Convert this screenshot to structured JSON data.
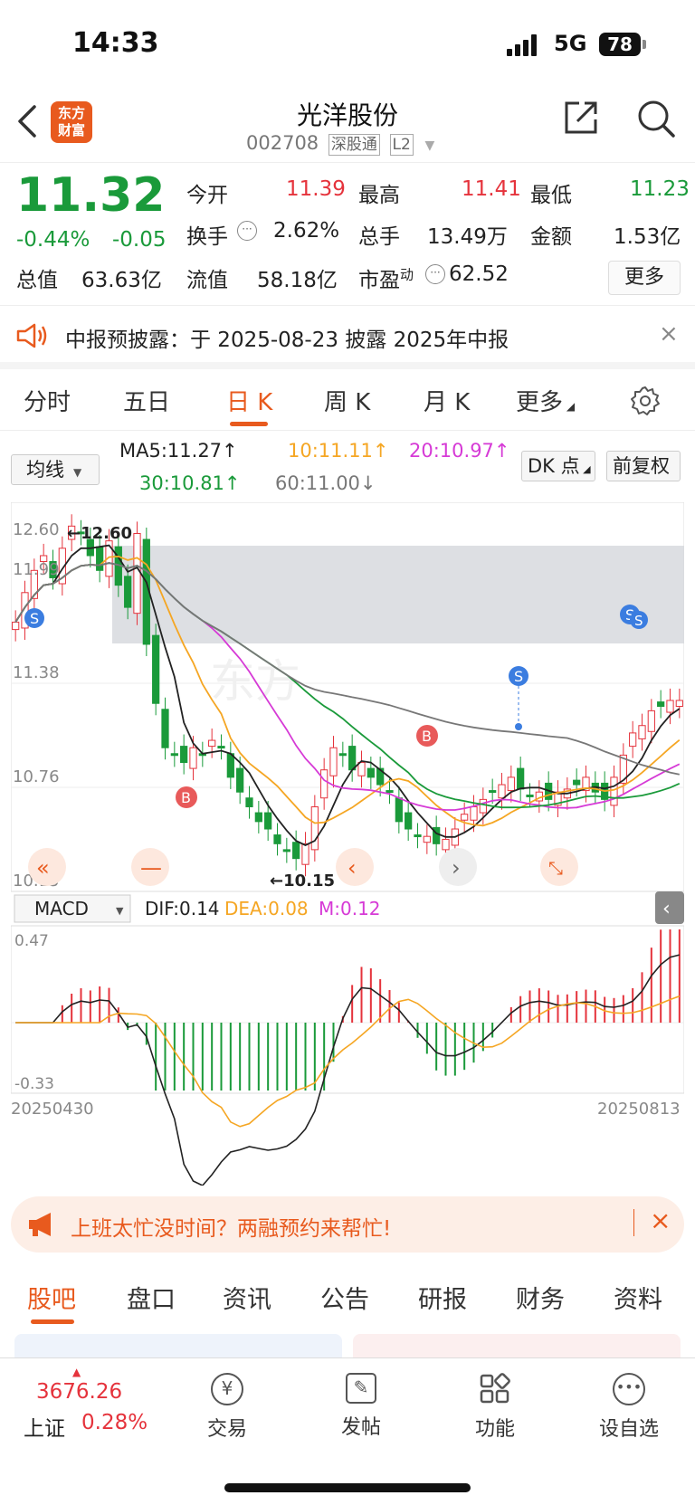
{
  "status": {
    "time": "14:33",
    "network": "5G",
    "battery": "78"
  },
  "nav": {
    "logo_top": "东方",
    "logo_bottom": "财富",
    "title": "光洋股份",
    "code": "002708",
    "tag1": "深股通",
    "tag2": "L2"
  },
  "quote": {
    "price": "11.32",
    "change_pct": "-0.44%",
    "change": "-0.05",
    "open_label": "今开",
    "open": "11.39",
    "high_label": "最高",
    "high": "11.41",
    "low_label": "最低",
    "low": "11.23",
    "turnover_label": "换手",
    "turnover": "2.62%",
    "volume_label": "总手",
    "volume": "13.49万",
    "amount_label": "金额",
    "amount": "1.53亿",
    "mktcap_label": "总值",
    "mktcap": "63.63亿",
    "float_label": "流值",
    "float": "58.18亿",
    "pe_label": "市盈",
    "pe_sup": "动",
    "pe": "62.52",
    "more": "更多"
  },
  "notice": {
    "text": "中报预披露：于 2025-08-23 披露 2025年中报"
  },
  "tabs": [
    "分时",
    "五日",
    "日 K",
    "周 K",
    "月 K",
    "更多"
  ],
  "ma": {
    "select": "均线",
    "ma5": "MA5:11.27↑",
    "ma10": "10:11.11↑",
    "ma20": "20:10.97↑",
    "ma30": "30:10.81↑",
    "ma60": "60:11.00↓",
    "dk": "DK 点",
    "adjust": "前复权"
  },
  "chart_data": [
    {
      "type": "candlestick",
      "y_ticks": [
        "12.60",
        "11.99",
        "11.38",
        "10.76",
        "10.15"
      ],
      "ylim": [
        10.15,
        12.6
      ],
      "annotations": {
        "high": "←12.60",
        "low": "←10.15"
      },
      "colors": {
        "up": "#e5333c",
        "down": "#1a9a3a",
        "ma5": "#222222",
        "ma10": "#f5a623",
        "ma20": "#d63ad6",
        "ma30": "#1a9a3a",
        "ma60": "#777777"
      }
    },
    {
      "type": "bar",
      "indicator": "MACD",
      "select": "MACD",
      "dif": "DIF:0.14",
      "dea": "DEA:0.08",
      "m": "M:0.12",
      "y_top": "0.47",
      "y_bottom": "-0.33",
      "x_start": "20250430",
      "x_end": "20250813"
    }
  ],
  "promo": {
    "text": "上班太忙没时间？两融预约来帮忙!"
  },
  "bottom_tabs": [
    "股吧",
    "盘口",
    "资讯",
    "公告",
    "研报",
    "财务",
    "资料"
  ],
  "bottom": {
    "index_value": "3676.26",
    "index_name": "上证",
    "index_change": "0.28%",
    "trade": "交易",
    "post": "发帖",
    "func": "功能",
    "watch": "设自选"
  }
}
